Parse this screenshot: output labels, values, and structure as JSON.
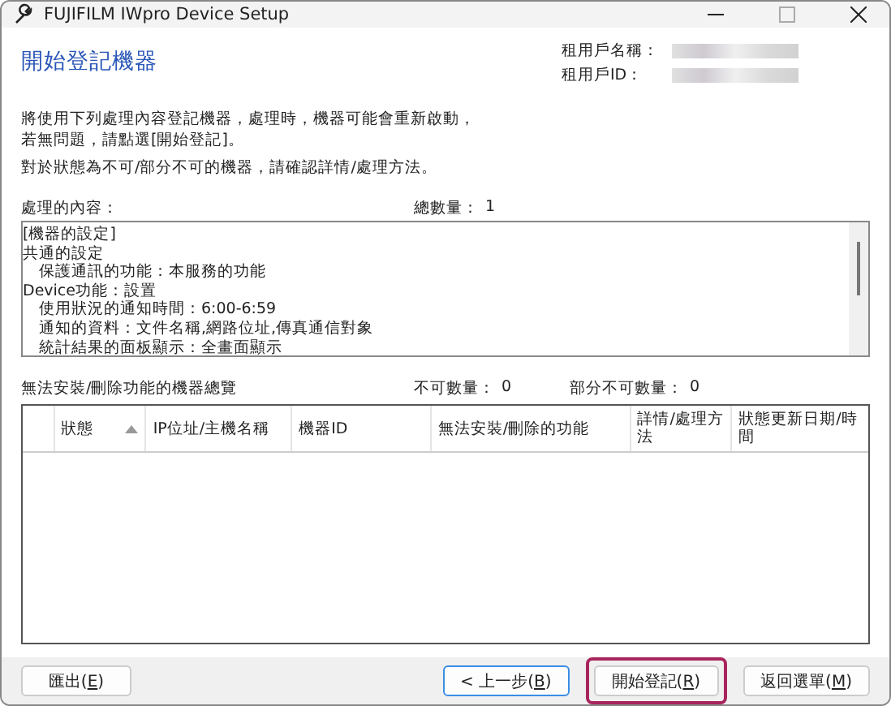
{
  "window": {
    "title": "FUJIFILM IWpro Device Setup"
  },
  "heading": "開始登記機器",
  "tenant": [
    {
      "label": "租用戶名稱："
    },
    {
      "label": "租用戶ID："
    }
  ],
  "intro": [
    "將使用下列處理內容登記機器，處理時，機器可能會重新啟動，",
    "若無問題，請點選[開始登記]。"
  ],
  "note": "對於狀態為不可/部分不可的機器，請確認詳情/處理方法。",
  "process": {
    "label": "處理的內容：",
    "total_label": "總數量：",
    "total": "1",
    "lines": [
      {
        "text": "[機器的設定]",
        "indent": false
      },
      {
        "text": "共通的設定",
        "indent": false
      },
      {
        "text": "保護通訊的功能：本服務的功能",
        "indent": true
      },
      {
        "text": "Device功能：設置",
        "indent": false
      },
      {
        "text": "使用狀況的通知時間：6:00-6:59",
        "indent": true
      },
      {
        "text": "通知的資料：文件名稱,網路位址,傳真通信對象",
        "indent": true
      },
      {
        "text": "統計結果的面板顯示：全畫面顯示",
        "indent": true
      }
    ]
  },
  "summary": {
    "label": "無法安裝/刪除功能的機器總覽",
    "unavailable_label": "不可數量：",
    "unavailable": "0",
    "partial_label": "部分不可數量：",
    "partial": "0"
  },
  "table": {
    "columns": [
      {
        "label": "狀態",
        "sorted": true
      },
      {
        "label": "IP位址/主機名稱",
        "sorted": false
      },
      {
        "label": "機器ID",
        "sorted": false
      },
      {
        "label": "無法安裝/刪除的功能",
        "sorted": false
      },
      {
        "label": "詳情/處理方法",
        "sorted": false
      },
      {
        "label": "狀態更新日期/時間",
        "sorted": false
      }
    ]
  },
  "buttons": [
    {
      "before": "匯出(",
      "mnemonic": "E",
      "after": ")",
      "focused": false,
      "highlighted": false
    },
    {
      "before": "< 上一步(",
      "mnemonic": "B",
      "after": ")",
      "focused": true,
      "highlighted": false
    },
    {
      "before": "開始登記(",
      "mnemonic": "R",
      "after": ")",
      "focused": false,
      "highlighted": true
    },
    {
      "before": "返回選單(",
      "mnemonic": "M",
      "after": ")",
      "focused": false,
      "highlighted": false
    }
  ]
}
